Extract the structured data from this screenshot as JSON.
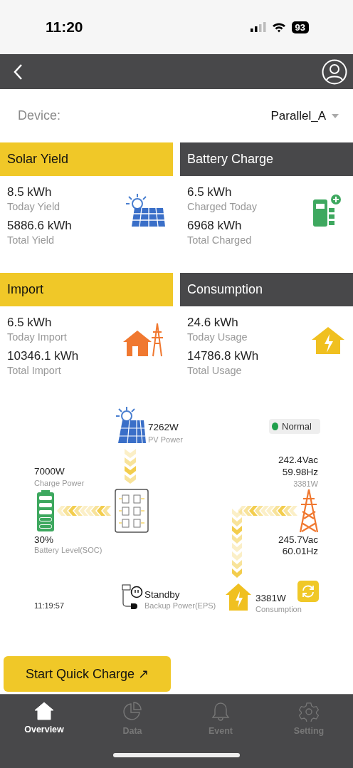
{
  "status_bar": {
    "time": "11:20",
    "battery": "93"
  },
  "device": {
    "label": "Device:",
    "value": "Parallel_A"
  },
  "cards": [
    {
      "title": "Solar Yield",
      "color": "#f0c828",
      "kind": "solar",
      "today_value": "8.5 kWh",
      "today_label": "Today Yield",
      "total_value": "5886.6 kWh",
      "total_label": "Total Yield"
    },
    {
      "title": "Battery Charge",
      "color": "#48484a",
      "kind": "battery",
      "today_value": "6.5 kWh",
      "today_label": "Charged Today",
      "total_value": "6968 kWh",
      "total_label": "Total Charged"
    },
    {
      "title": "Import",
      "color": "#f0c828",
      "kind": "import",
      "today_value": "6.5 kWh",
      "today_label": "Today Import",
      "total_value": "10346.1 kWh",
      "total_label": "Total Import"
    },
    {
      "title": "Consumption",
      "color": "#48484a",
      "kind": "consumption",
      "today_value": "24.6 kWh",
      "today_label": "Today Usage",
      "total_value": "14786.8 kWh",
      "total_label": "Total Usage"
    }
  ],
  "flow": {
    "pv_power": "7262W",
    "pv_label": "PV Power",
    "status": {
      "label": "Normal",
      "color": "#1e9e4a"
    },
    "charge_power": "7000W",
    "charge_label": "Charge Power",
    "battery_percent": "30%",
    "battery_label": "Battery Level(SOC)",
    "grid_voltage_1": "242.4Vac",
    "grid_freq_1": "59.98Hz",
    "grid_power": "3381W",
    "grid_voltage_2": "245.7Vac",
    "grid_freq_2": "60.01Hz",
    "eps_status": "Standby",
    "eps_label": "Backup Power(EPS)",
    "load_power": "3381W",
    "load_label": "Consumption",
    "time": "11:19:57"
  },
  "quick_charge": {
    "label": "Start Quick Charge ↗"
  },
  "tabs": [
    {
      "label": "Overview",
      "selected": true,
      "kind": "home"
    },
    {
      "label": "Data",
      "selected": false,
      "kind": "chart"
    },
    {
      "label": "Event",
      "selected": false,
      "kind": "bell"
    },
    {
      "label": "Setting",
      "selected": false,
      "kind": "gear"
    }
  ]
}
